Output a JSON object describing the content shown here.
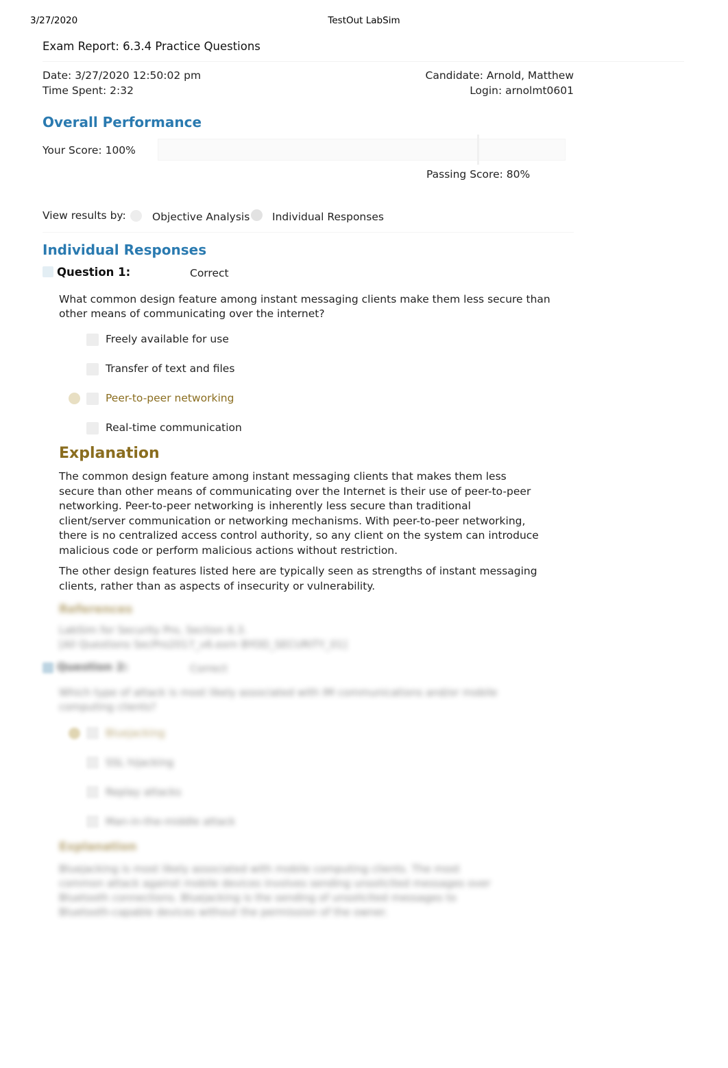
{
  "header": {
    "date": "3/27/2020",
    "app_title": "TestOut LabSim"
  },
  "report": {
    "title": "Exam Report: 6.3.4 Practice Questions",
    "date_line": "Date: 3/27/2020 12:50:02 pm",
    "time_spent_line": "Time Spent: 2:32",
    "candidate_line": "Candidate: Arnold, Matthew",
    "login_line": "Login: arnolmt0601"
  },
  "overall": {
    "heading": "Overall Performance",
    "your_score_label": "Your Score: 100%",
    "passing_score_label": "Passing Score: 80%",
    "score_percent": 100,
    "passing_percent": 80
  },
  "view_results": {
    "label": "View results by:",
    "options": [
      {
        "label": "Objective Analysis",
        "selected": false
      },
      {
        "label": "Individual Responses",
        "selected": true
      }
    ]
  },
  "individual_responses": {
    "heading": "Individual Responses",
    "questions": [
      {
        "label": "Question 1:",
        "status": "Correct",
        "prompt": "What common design feature among instant messaging clients make them less secure than other means of communicating over the internet?",
        "options": [
          {
            "text": "Freely available for use",
            "correct": false
          },
          {
            "text": "Transfer of text and files",
            "correct": false
          },
          {
            "text": "Peer-to-peer networking",
            "correct": true
          },
          {
            "text": "Real-time communication",
            "correct": false
          }
        ],
        "explanation_heading": "Explanation",
        "explanation_paragraphs": [
          "The common design feature among instant messaging clients that makes them less secure than other means of communicating over the Internet is their use of peer-to-peer networking. Peer-to-peer networking is inherently less secure than traditional client/server communication or networking mechanisms. With peer-to-peer networking, there is no centralized access control authority, so any client on the system can introduce malicious code or perform malicious actions without restriction.",
          "The other design features listed here are typically seen as strengths of instant messaging clients, rather than as aspects of insecurity or vulnerability."
        ]
      }
    ]
  },
  "blurred_content": {
    "references_heading": "References",
    "references_lines": [
      "LabSim for Security Pro, Section 6.3.",
      "[All Questions SecPro2017_v6.exm BYOD_SECURITY_01]"
    ],
    "question2_label": "Question 2:",
    "question2_status": "Correct",
    "question2_prompt": "Which type of attack is most likely associated with IM communications and/or mobile computing clients?",
    "question2_options": [
      {
        "text": "Bluejacking",
        "correct": true
      },
      {
        "text": "SSL hijacking",
        "correct": false
      },
      {
        "text": "Replay attacks",
        "correct": false
      },
      {
        "text": "Man-in-the-middle attack",
        "correct": false
      }
    ],
    "question2_explanation_heading": "Explanation",
    "question2_explanation": "Bluejacking is most likely associated with mobile computing clients. The most common attack against mobile devices involves sending unsolicited messages over Bluetooth connections. Bluejacking is the sending of unsolicited messages to Bluetooth-capable devices without the permission of the owner."
  }
}
